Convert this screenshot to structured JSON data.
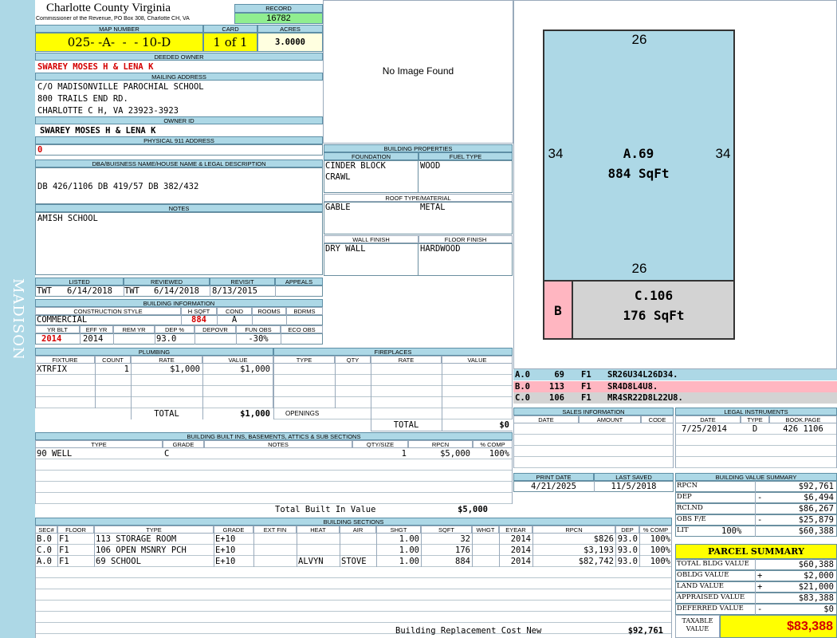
{
  "header": {
    "county": "Charlotte County Virginia",
    "commissioner": "Commissioner of the Revenue, PO Box 308, Charlotte CH, VA",
    "record_label": "RECORD",
    "record_value": "16782"
  },
  "labels": {
    "map_number": "MAP NUMBER",
    "card": "CARD",
    "acres": "ACRES",
    "deeded_owner": "DEEDED OWNER",
    "mailing_address": "MAILING ADDRESS",
    "owner_id": "OWNER ID",
    "physical_address": "PHYSICAL 911 ADDRESS",
    "dba": "DBA/BUISNESS NAME/HOUSE NAME & LEGAL DESCRIPTION",
    "notes": "NOTES"
  },
  "parcel": {
    "map_number": "025- -A-  -  - 10-D",
    "card": "1 of 1",
    "acres": "3.0000",
    "deeded_owner": "SWAREY MOSES H & LENA K",
    "mailing": [
      "C/O MADISONVILLE PAROCHIAL SCHOOL",
      "800 TRAILS END RD.",
      "CHARLOTTE C H, VA 23923-3923"
    ],
    "owner_id": "SWAREY MOSES H & LENA K",
    "physical_address": "0",
    "dba": "DB 426/1106 DB 419/57 DB 382/432",
    "notes": "AMISH SCHOOL"
  },
  "side_label": "MADISON",
  "image_placeholder": "No Image Found",
  "building_properties": {
    "title": "BUILDING PROPERTIES",
    "foundation_label": "FOUNDATION",
    "fuel_label": "FUEL TYPE",
    "foundation": [
      "CINDER BLOCK",
      "CRAWL"
    ],
    "fuel": "WOOD",
    "roof_label": "ROOF TYPE/MATERIAL",
    "roof_type": "GABLE",
    "roof_material": "METAL",
    "wall_label": "WALL FINISH",
    "floor_label": "FLOOR FINISH",
    "wall": "DRY WALL",
    "floor": "HARDWOOD"
  },
  "listing": {
    "labels": [
      "LISTED",
      "REVIEWED",
      "REVISIT",
      "APPEALS"
    ],
    "listed_by": "TWT",
    "listed": "6/14/2018",
    "reviewed_by": "TWT",
    "reviewed": "6/14/2018",
    "revisit": "8/13/2015",
    "appeals": ""
  },
  "building_info": {
    "title": "BUILDING INFORMATION",
    "labels": [
      "CONSTRUCTION STYLE",
      "H SQFT",
      "COND",
      "ROOMS",
      "BDRMS"
    ],
    "style": "COMMERCIAL",
    "hsqft": "884",
    "cond": "A",
    "rooms": "",
    "bdrms": "",
    "labels2": [
      "YR BLT",
      "EFF YR",
      "REM YR",
      "DEP %",
      "DEPOVR",
      "FUN OBS",
      "ECO OBS"
    ],
    "yr_blt": "2014",
    "eff_yr": "2014",
    "rem_yr": "",
    "dep": "93.0",
    "depovr": "",
    "fun_obs": "-30%",
    "eco_obs": ""
  },
  "plumbing": {
    "title": "PLUMBING",
    "headers": [
      "FIXTURE",
      "COUNT",
      "RATE",
      "VALUE"
    ],
    "rows": [
      {
        "fixture": "XTRFIX",
        "count": "1",
        "rate": "$1,000",
        "value": "$1,000"
      }
    ],
    "total_label": "TOTAL",
    "total": "$1,000"
  },
  "fireplaces": {
    "title": "FIREPLACES",
    "headers": [
      "TYPE",
      "QTY",
      "RATE",
      "VALUE"
    ],
    "openings_label": "OPENINGS",
    "total_label": "TOTAL",
    "total": "$0"
  },
  "built_ins": {
    "title": "BUILDING BUILT INS, BASEMENTS, ATTICS & SUB SECTIONS",
    "headers": [
      "TYPE",
      "GRADE",
      "NOTES",
      "QTY/SIZE",
      "RPCN",
      "% COMP"
    ],
    "rows": [
      {
        "type": "90 WELL",
        "grade": "C",
        "notes": "",
        "qty": "1",
        "rpcn": "$5,000",
        "comp": "100%"
      }
    ],
    "total_label": "Total Built In Value",
    "total": "$5,000"
  },
  "sections": {
    "title": "BUILDING SECTIONS",
    "headers": [
      "SEC#",
      "FLOOR",
      "TYPE",
      "GRADE",
      "EXT FIN",
      "HEAT",
      "AIR",
      "SHGT",
      "SQFT",
      "WHGT",
      "EYEAR",
      "RPCN",
      "DEP",
      "% COMP"
    ],
    "rows": [
      {
        "sec": "B.0",
        "floor": "F1",
        "type": "113 STORAGE ROOM",
        "grade": "E+10",
        "ext": "",
        "heat": "",
        "air": "",
        "shgt": "1.00",
        "sqft": "32",
        "whgt": "",
        "eyear": "2014",
        "rpcn": "$826",
        "dep": "93.0",
        "comp": "100%"
      },
      {
        "sec": "C.0",
        "floor": "F1",
        "type": "106 OPEN MSNRY PCH",
        "grade": "E+10",
        "ext": "",
        "heat": "",
        "air": "",
        "shgt": "1.00",
        "sqft": "176",
        "whgt": "",
        "eyear": "2014",
        "rpcn": "$3,193",
        "dep": "93.0",
        "comp": "100%"
      },
      {
        "sec": "A.0",
        "floor": "F1",
        "type": "69 SCHOOL",
        "grade": "E+10",
        "ext": "",
        "heat": "ALVYN",
        "air": "STOVE",
        "shgt": "1.00",
        "sqft": "884",
        "whgt": "",
        "eyear": "2014",
        "rpcn": "$82,742",
        "dep": "93.0",
        "comp": "100%"
      }
    ],
    "replacement_label": "Building Replacement Cost New",
    "replacement": "$92,761"
  },
  "sketch": {
    "top": "26",
    "left": "34",
    "right": "34",
    "bottom": "26",
    "a_label": "A.69",
    "a_sqft": "884 SqFt",
    "b_label": "B",
    "c_label": "C.106",
    "c_sqft": "176 SqFt",
    "colors": {
      "a": "#add8e6",
      "b": "#ffb6c1",
      "c": "#d3d3d3"
    }
  },
  "sketch_legend": [
    {
      "code": "A.0",
      "num": "69",
      "floor": "F1",
      "path": "SR26U34L26D34."
    },
    {
      "code": "B.0",
      "num": "113",
      "floor": "F1",
      "path": "SR4D8L4U8."
    },
    {
      "code": "C.0",
      "num": "106",
      "floor": "F1",
      "path": "MR4SR22D8L22U8."
    }
  ],
  "sales": {
    "title": "SALES INFORMATION",
    "headers": [
      "DATE",
      "AMOUNT",
      "CODE"
    ]
  },
  "legal": {
    "title": "LEGAL INSTRUMENTS",
    "headers": [
      "DATE",
      "TYPE",
      "BOOK.PAGE"
    ],
    "rows": [
      {
        "date": "7/25/2014",
        "type": "D",
        "book": "426 1106"
      }
    ]
  },
  "print": {
    "print_label": "PRINT DATE",
    "saved_label": "LAST SAVED",
    "print_date": "4/21/2025",
    "last_saved": "11/5/2018"
  },
  "value_summary": {
    "title": "BUILDING VALUE SUMMARY",
    "rows": [
      {
        "label": "RPCN",
        "sign": "",
        "value": "$92,761"
      },
      {
        "label": "DEP",
        "sign": "-",
        "value": "$6,494"
      },
      {
        "label": "RCLND",
        "sign": "",
        "value": "$86,267"
      },
      {
        "label": "OBS F/E",
        "sign": "-",
        "value": "$25,879"
      },
      {
        "label": "LIT",
        "sign": "100%",
        "value": "$60,388"
      }
    ]
  },
  "parcel_summary": {
    "title": "PARCEL SUMMARY",
    "rows": [
      {
        "label": "TOTAL BLDG VALUE",
        "sign": "",
        "value": "$60,388"
      },
      {
        "label": "OBLDG VALUE",
        "sign": "+",
        "value": "$2,000"
      },
      {
        "label": "LAND VALUE",
        "sign": "+",
        "value": "$21,000"
      },
      {
        "label": "APPRAISED VALUE",
        "sign": "",
        "value": "$83,388"
      },
      {
        "label": "DEFERRED VALUE",
        "sign": "-",
        "value": "$0"
      }
    ],
    "taxable_label1": "TAXABLE",
    "taxable_label2": "VALUE",
    "taxable": "$83,388"
  }
}
